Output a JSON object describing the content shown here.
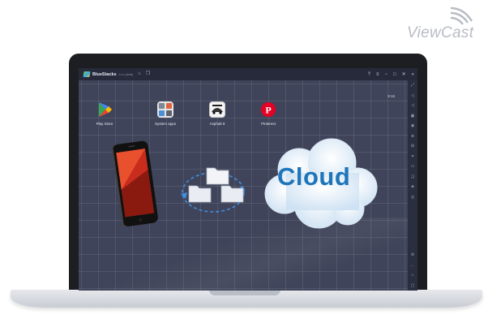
{
  "watermark": {
    "text": "ViewCast"
  },
  "window": {
    "app_name": "BlueStacks",
    "app_version": "4.x.x (beta)",
    "clock": "9:16",
    "controls": [
      "?",
      "≡",
      "−",
      "□",
      "✕",
      "«"
    ]
  },
  "desktop_apps": [
    {
      "label": "Play Store",
      "icon": "play-store-icon"
    },
    {
      "label": "System apps",
      "icon": "system-apps-icon"
    },
    {
      "label": "Asphalt 9",
      "icon": "asphalt-icon"
    },
    {
      "label": "Pinterest",
      "icon": "pinterest-icon"
    }
  ],
  "illustration": {
    "cloud_text": "Cloud",
    "colors": {
      "cloud_text": "#1f75b9",
      "sync_arrows": "#3d8fdc",
      "folder": "#e9ecf2"
    }
  },
  "toolbar_icons": [
    "expand-icon",
    "volume-up-icon",
    "volume-down-icon",
    "screen-icon",
    "camera-icon",
    "apk-install-icon",
    "gamepad-icon",
    "screenshot-icon",
    "folder-icon",
    "copy-icon",
    "layers-icon",
    "location-icon",
    "settings-icon",
    "back-icon",
    "home-icon",
    "recent-apps-icon"
  ],
  "colors": {
    "titlebar": "#262a3a",
    "desktop": "#40445a",
    "toolbar": "#2a2e3e",
    "laptop_bezel": "#1d1e22"
  }
}
